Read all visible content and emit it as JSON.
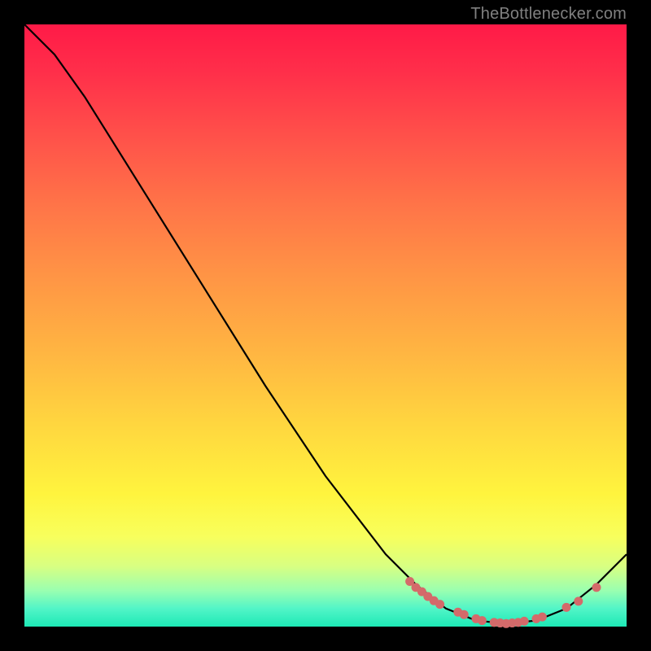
{
  "attribution": "TheBottlenecker.com",
  "chart_data": {
    "type": "line",
    "title": "",
    "xlabel": "",
    "ylabel": "",
    "xlim": [
      0,
      100
    ],
    "ylim": [
      0,
      100
    ],
    "curve": [
      {
        "x": 0,
        "y": 100
      },
      {
        "x": 5,
        "y": 95
      },
      {
        "x": 10,
        "y": 88
      },
      {
        "x": 20,
        "y": 72
      },
      {
        "x": 30,
        "y": 56
      },
      {
        "x": 40,
        "y": 40
      },
      {
        "x": 50,
        "y": 25
      },
      {
        "x": 60,
        "y": 12
      },
      {
        "x": 65,
        "y": 7
      },
      {
        "x": 70,
        "y": 3
      },
      {
        "x": 75,
        "y": 1
      },
      {
        "x": 80,
        "y": 0.5
      },
      {
        "x": 85,
        "y": 1
      },
      {
        "x": 90,
        "y": 3
      },
      {
        "x": 95,
        "y": 7
      },
      {
        "x": 100,
        "y": 12
      }
    ],
    "markers": [
      {
        "x": 64,
        "y": 7.5
      },
      {
        "x": 65,
        "y": 6.5
      },
      {
        "x": 66,
        "y": 5.8
      },
      {
        "x": 67,
        "y": 5.0
      },
      {
        "x": 68,
        "y": 4.3
      },
      {
        "x": 69,
        "y": 3.7
      },
      {
        "x": 72,
        "y": 2.4
      },
      {
        "x": 73,
        "y": 2.0
      },
      {
        "x": 75,
        "y": 1.3
      },
      {
        "x": 76,
        "y": 1.0
      },
      {
        "x": 78,
        "y": 0.7
      },
      {
        "x": 79,
        "y": 0.6
      },
      {
        "x": 80,
        "y": 0.5
      },
      {
        "x": 81,
        "y": 0.6
      },
      {
        "x": 82,
        "y": 0.7
      },
      {
        "x": 83,
        "y": 0.9
      },
      {
        "x": 85,
        "y": 1.3
      },
      {
        "x": 86,
        "y": 1.6
      },
      {
        "x": 90,
        "y": 3.2
      },
      {
        "x": 92,
        "y": 4.2
      },
      {
        "x": 95,
        "y": 6.5
      }
    ],
    "marker_color": "#d46a6a",
    "line_color": "#000000"
  }
}
